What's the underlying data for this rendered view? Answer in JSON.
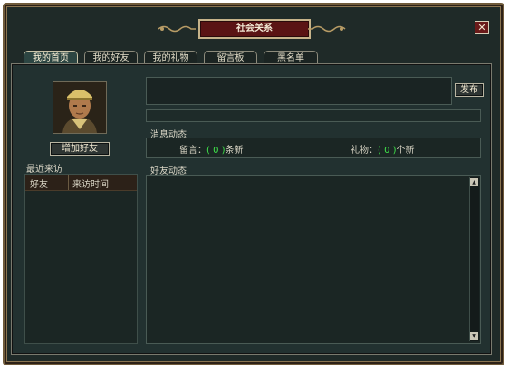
{
  "window": {
    "title": "社会关系"
  },
  "tabs": [
    {
      "label": "我的首页",
      "active": true
    },
    {
      "label": "我的好友",
      "active": false
    },
    {
      "label": "我的礼物",
      "active": false
    },
    {
      "label": "留言板",
      "active": false
    },
    {
      "label": "黑名单",
      "active": false
    }
  ],
  "profile": {
    "add_friend_label": "增加好友",
    "recent_visits_label": "最近来访",
    "columns": [
      "好友",
      "来访时间"
    ]
  },
  "post": {
    "input_value": "",
    "publish_label": "发布"
  },
  "messages": {
    "heading": "消息动态",
    "comment_prefix": "留言：",
    "comment_count": "( 0 )",
    "comment_suffix": "条新",
    "gift_prefix": "礼物：",
    "gift_count": "( 0 )",
    "gift_suffix": "个新"
  },
  "friend_feed": {
    "heading": "好友动态"
  },
  "icons": {
    "close": "close-icon",
    "avatar": "player-portrait",
    "scroll_up": "arrow-up-icon",
    "scroll_down": "arrow-down-icon"
  },
  "colors": {
    "title_bg": "#5a1414",
    "panel_bg": "#1f2a28",
    "count_green": "#3fe44a",
    "frame_border": "#8a7450"
  }
}
